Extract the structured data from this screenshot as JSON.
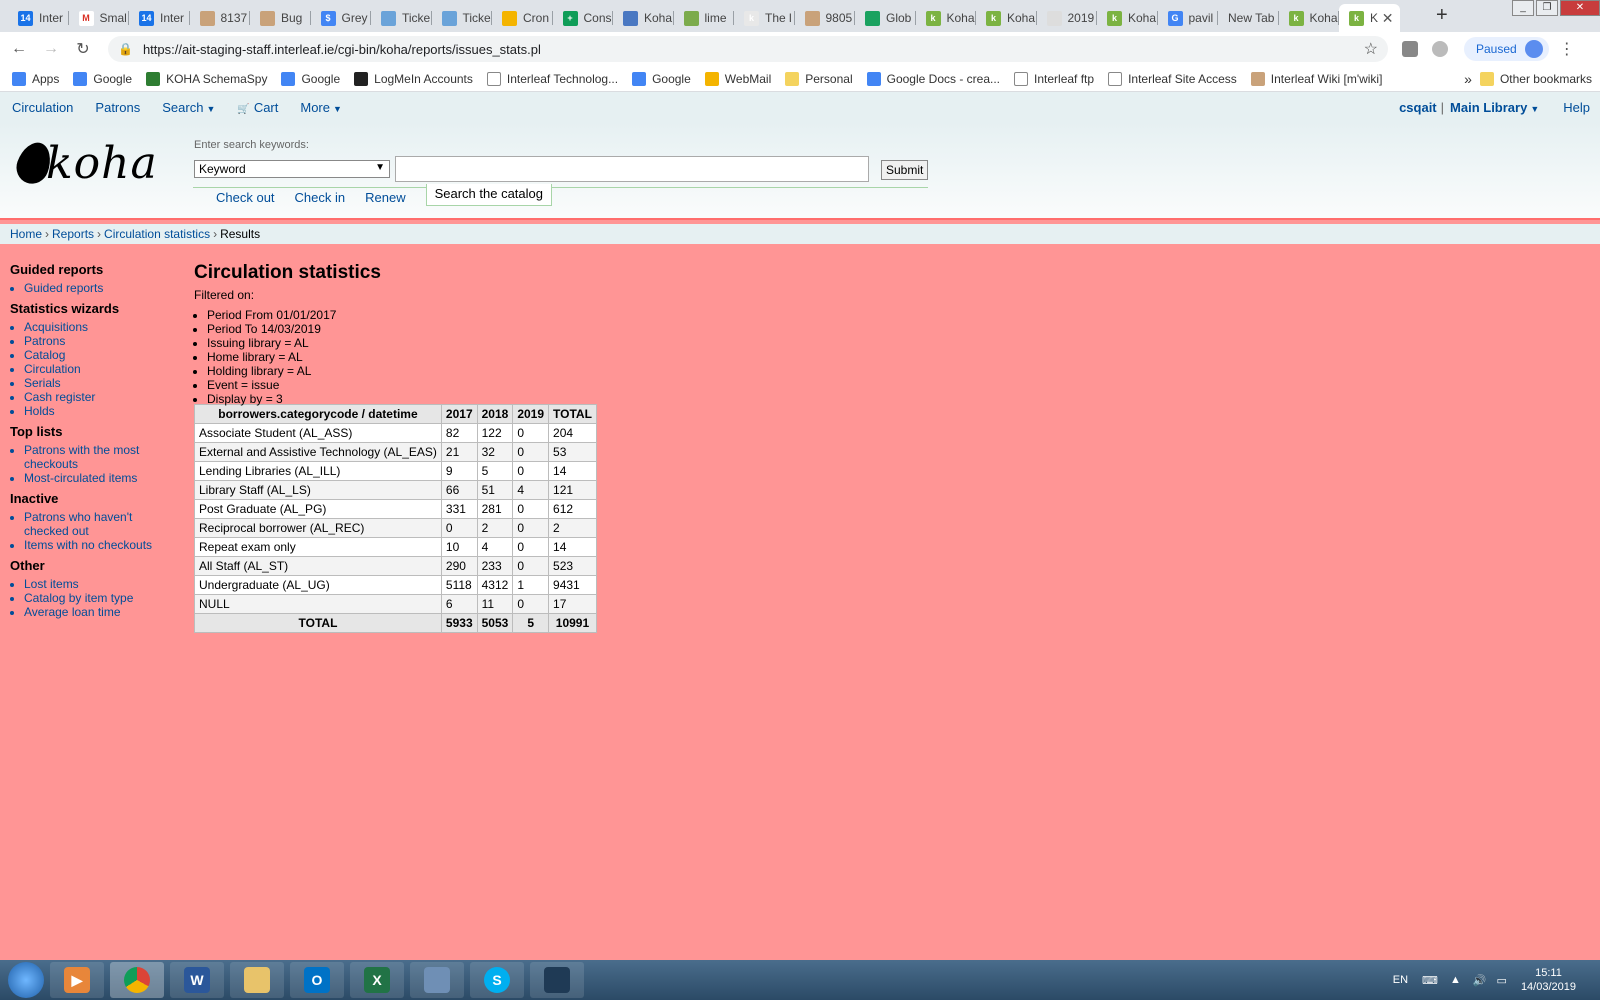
{
  "browser": {
    "tabs": [
      "Inter",
      "Smal",
      "Inter",
      "8137",
      "Bug",
      "Grey",
      "Ticke",
      "Ticke",
      "Cron",
      "Cons",
      "Koha",
      "lime",
      "The l",
      "9805",
      "Glob",
      "Koha",
      "Koha",
      "2019",
      "Koha",
      "pavil",
      "New Tab",
      "Koha",
      "K"
    ],
    "active_tab_index": 22,
    "new_tab_label": "+",
    "url": "https://ait-staging-staff.interleaf.ie/cgi-bin/koha/reports/issues_stats.pl",
    "profile_status": "Paused",
    "bookmarks": [
      "Apps",
      "Google",
      "KOHA SchemaSpy",
      "Google",
      "LogMeIn Accounts",
      "Interleaf Technolog...",
      "Google",
      "WebMail",
      "Personal",
      "Google Docs - crea...",
      "Interleaf ftp",
      "Interleaf Site Access",
      "Interleaf Wiki [m'wiki]"
    ],
    "more_bookmarks": "»",
    "other_bookmarks": "Other bookmarks"
  },
  "koha": {
    "nav": {
      "circulation": "Circulation",
      "patrons": "Patrons",
      "search": "Search",
      "cart": "Cart",
      "more": "More",
      "user": "csqait",
      "separator": "|",
      "library": "Main Library",
      "help": "Help"
    },
    "logo_text": "koha",
    "search": {
      "label": "Enter search keywords:",
      "type": "Keyword",
      "submit": "Submit",
      "tabs": [
        "Check out",
        "Check in",
        "Renew",
        "Search the catalog"
      ]
    },
    "breadcrumbs": [
      "Home",
      "Reports",
      "Circulation statistics",
      "Results"
    ],
    "breadcrumb_sep": "›",
    "sidebar": [
      {
        "heading": "Guided reports",
        "items": [
          "Guided reports"
        ]
      },
      {
        "heading": "Statistics wizards",
        "items": [
          "Acquisitions",
          "Patrons",
          "Catalog",
          "Circulation",
          "Serials",
          "Cash register",
          "Holds"
        ]
      },
      {
        "heading": "Top lists",
        "items": [
          "Patrons with the most checkouts",
          "Most-circulated items"
        ]
      },
      {
        "heading": "Inactive",
        "items": [
          "Patrons who haven't checked out",
          "Items with no checkouts"
        ]
      },
      {
        "heading": "Other",
        "items": [
          "Lost items",
          "Catalog by item type",
          "Average loan time"
        ]
      }
    ],
    "page_title": "Circulation statistics",
    "filtered_on": "Filtered on:",
    "filters": [
      "Period From 01/01/2017",
      "Period To 14/03/2019",
      "Issuing library = AL",
      "Home library = AL",
      "Holding library = AL",
      "Event = issue",
      "Display by = 3"
    ],
    "table": {
      "headers": [
        "borrowers.categorycode / datetime",
        "2017",
        "2018",
        "2019",
        "TOTAL"
      ],
      "rows": [
        [
          "Associate Student (AL_ASS)",
          "82",
          "122",
          "0",
          "204"
        ],
        [
          "External and Assistive Technology (AL_EAS)",
          "21",
          "32",
          "0",
          "53"
        ],
        [
          "Lending Libraries (AL_ILL)",
          "9",
          "5",
          "0",
          "14"
        ],
        [
          "Library Staff (AL_LS)",
          "66",
          "51",
          "4",
          "121"
        ],
        [
          "Post Graduate (AL_PG)",
          "331",
          "281",
          "0",
          "612"
        ],
        [
          "Reciprocal borrower (AL_REC)",
          "0",
          "2",
          "0",
          "2"
        ],
        [
          "Repeat exam only",
          "10",
          "4",
          "0",
          "14"
        ],
        [
          "All Staff (AL_ST)",
          "290",
          "233",
          "0",
          "523"
        ],
        [
          "Undergraduate (AL_UG)",
          "5118",
          "4312",
          "1",
          "9431"
        ],
        [
          "NULL",
          "6",
          "11",
          "0",
          "17"
        ]
      ],
      "footer": [
        "TOTAL",
        "5933",
        "5053",
        "5",
        "10991"
      ]
    }
  },
  "taskbar": {
    "language": "EN",
    "time": "15:11",
    "date": "14/03/2019"
  },
  "colors": {
    "page_background": "#ff9595",
    "link": "#004d99",
    "header_background": "#e6f0f2"
  }
}
